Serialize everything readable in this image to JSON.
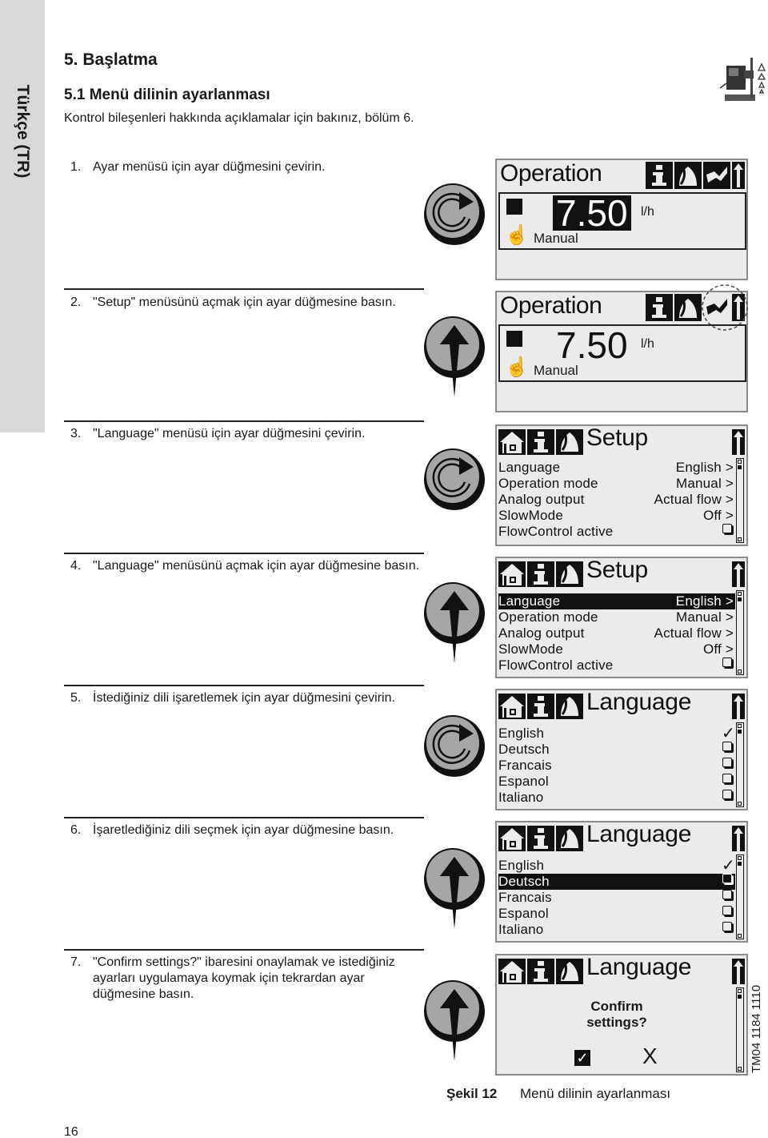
{
  "side_tab": {
    "label": "Türkçe (TR)"
  },
  "product_icon": "dosing-pump-icon",
  "heading": "5. Başlatma",
  "subheading": "5.1 Menü dilinin ayarlanması",
  "intro": "Kontrol bileşenleri hakkında açıklamalar için bakınız, bölüm 6.",
  "steps": [
    {
      "num": "1.",
      "text": "Ayar menüsü için ayar düğmesini çevirin.",
      "action": "turn",
      "icon": "rotate-knob-icon"
    },
    {
      "num": "2.",
      "text": "\"Setup\" menüsünü açmak için ayar düğmesine basın.",
      "action": "press",
      "icon": "press-knob-icon"
    },
    {
      "num": "3.",
      "text": "\"Language\" menüsü için ayar düğmesini çevirin.",
      "action": "turn",
      "icon": "rotate-knob-icon"
    },
    {
      "num": "4.",
      "text": "\"Language\" menüsünü açmak için ayar düğmesine basın.",
      "action": "press",
      "icon": "press-knob-icon"
    },
    {
      "num": "5.",
      "text": "İstediğiniz dili işaretlemek için ayar düğmesini çevirin.",
      "action": "turn",
      "icon": "rotate-knob-icon"
    },
    {
      "num": "6.",
      "text": "İşaretlediğiniz dili seçmek için ayar düğmesine basın.",
      "action": "press",
      "icon": "press-knob-icon"
    },
    {
      "num": "7.",
      "text": "\"Confirm settings?\" ibaresini onaylamak ve istediğiniz ayarları uygulamaya koymak için tekrardan ayar düğmesine basın.",
      "action": "press",
      "icon": "press-knob-icon"
    }
  ],
  "screens": {
    "s1": {
      "title": "Operation",
      "value": "7.50",
      "unit": "l/h",
      "mode": "Manual",
      "value_highlighted": true,
      "tabs": [
        "info-icon",
        "alarm-bell-icon",
        "setup-wrench-icon",
        "up-arrow-icon"
      ]
    },
    "s2": {
      "title": "Operation",
      "value": "7.50",
      "unit": "l/h",
      "mode": "Manual",
      "value_highlighted": false,
      "highlighted_tab": "setup-wrench-icon"
    },
    "s3": {
      "title": "Setup",
      "rows": [
        {
          "label": "Language",
          "value": "English >"
        },
        {
          "label": "Operation mode",
          "value": "Manual >"
        },
        {
          "label": "Analog output",
          "value": "Actual flow >"
        },
        {
          "label": "SlowMode",
          "value": "Off >"
        },
        {
          "label": "FlowControl active",
          "value": "checkbox-unchecked"
        }
      ],
      "selected_row": null
    },
    "s4": {
      "title": "Setup",
      "rows": [
        {
          "label": "Language",
          "value": "English >"
        },
        {
          "label": "Operation mode",
          "value": "Manual >"
        },
        {
          "label": "Analog output",
          "value": "Actual flow >"
        },
        {
          "label": "SlowMode",
          "value": "Off >"
        },
        {
          "label": "FlowControl active",
          "value": "checkbox-unchecked"
        }
      ],
      "selected_row": "Language"
    },
    "s5": {
      "title": "Language",
      "options": [
        "English",
        "Deutsch",
        "Francais",
        "Espanol",
        "Italiano"
      ],
      "checked": "English",
      "selected_row": null
    },
    "s6": {
      "title": "Language",
      "options": [
        "English",
        "Deutsch",
        "Francais",
        "Espanol",
        "Italiano"
      ],
      "checked": "English",
      "selected_row": "Deutsch"
    },
    "s7": {
      "title": "Language",
      "confirm_line1": "Confirm",
      "confirm_line2": "settings?",
      "yes_glyph": "✓",
      "no_glyph": "X"
    },
    "check_glyph": "✓",
    "hand_glyph": "☝"
  },
  "drawing_code": "TM04 1184 1110",
  "caption": {
    "label": "Şekil 12",
    "text": "Menü dilinin ayarlanması"
  },
  "page_number": "16"
}
